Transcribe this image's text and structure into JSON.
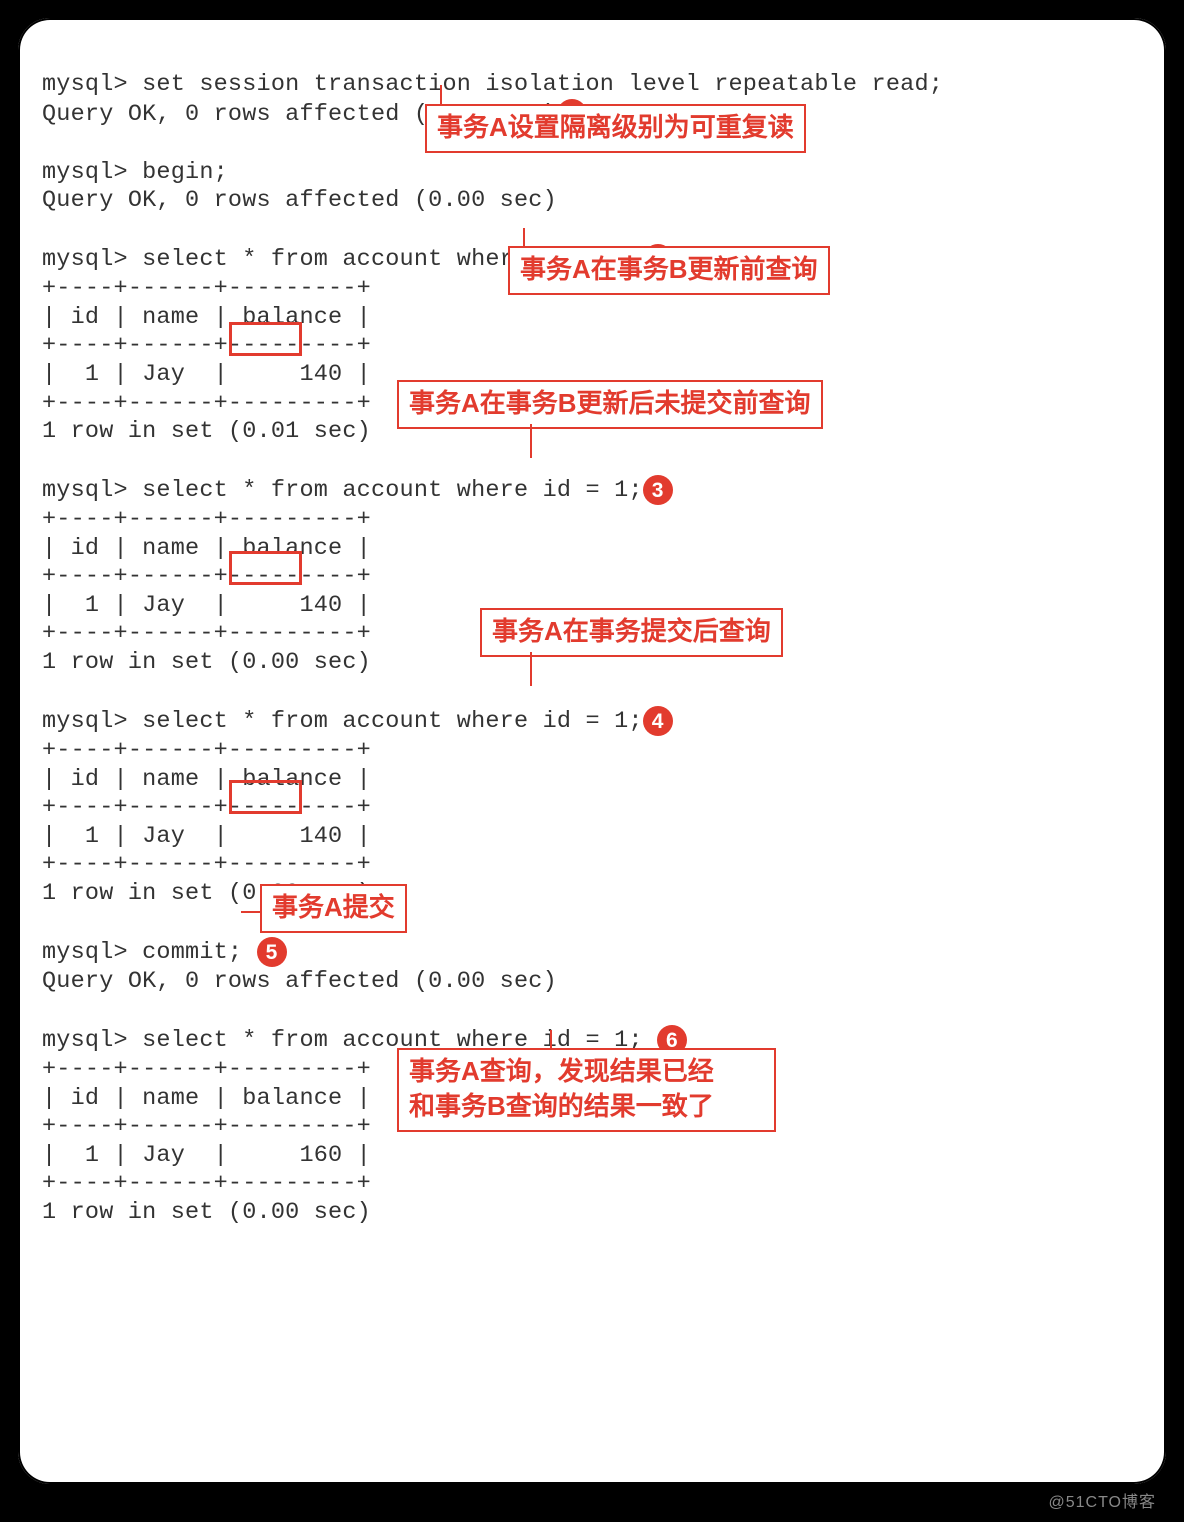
{
  "watermark": "@51CTO博客",
  "terminal": {
    "line1": "mysql> set session transaction isolation level repeatable read;",
    "line2": "Query OK, 0 rows affected (0.00 sec)",
    "blank1": "",
    "line3": "mysql> begin;",
    "line4": "Query OK, 0 rows affected (0.00 sec)",
    "blank2": "",
    "line5": "mysql> select * from account where id = 1;",
    "line6": "+----+------+---------+",
    "line7": "| id | name | balance |",
    "line8": "+----+------+---------+",
    "line9": "|  1 | Jay  |     140 |",
    "line10": "+----+------+---------+",
    "line11": "1 row in set (0.01 sec)",
    "blank3": "",
    "line12": "mysql> select * from account where id = 1;",
    "line13": "+----+------+---------+",
    "line14": "| id | name | balance |",
    "line15": "+----+------+---------+",
    "line16": "|  1 | Jay  |     140 |",
    "line17": "+----+------+---------+",
    "line18": "1 row in set (0.00 sec)",
    "blank4": "",
    "line19": "mysql> select * from account where id = 1;",
    "line20": "+----+------+---------+",
    "line21": "| id | name | balance |",
    "line22": "+----+------+---------+",
    "line23": "|  1 | Jay  |     140 |",
    "line24": "+----+------+---------+",
    "line25": "1 row in set (0.00 sec)",
    "blank5": "",
    "line26_a": "mysql> commit; ",
    "line27": "Query OK, 0 rows affected (0.00 sec)",
    "blank6": "",
    "line28": "mysql> select * from account where id = 1; ",
    "line29": "+----+------+---------+",
    "line30": "| id | name | balance |",
    "line31": "+----+------+---------+",
    "line32": "|  1 | Jay  |     160 |",
    "line33": "+----+------+---------+",
    "line34": "1 row in set (0.00 sec)"
  },
  "badges": {
    "b1": "1",
    "b2": "2",
    "b3": "3",
    "b4": "4",
    "b5": "5",
    "b6": "6"
  },
  "annotations": {
    "a1": "事务A设置隔离级别为可重复读",
    "a2": "事务A在事务B更新前查询",
    "a3": "事务A在事务B更新后未提交前查询",
    "a4": "事务A在事务提交后查询",
    "a5": "事务A提交",
    "a6_line1": "事务A查询，发现结果已经",
    "a6_line2": "和事务B查询的结果一致了"
  },
  "highlights_values": [
    "140",
    "140",
    "140"
  ]
}
